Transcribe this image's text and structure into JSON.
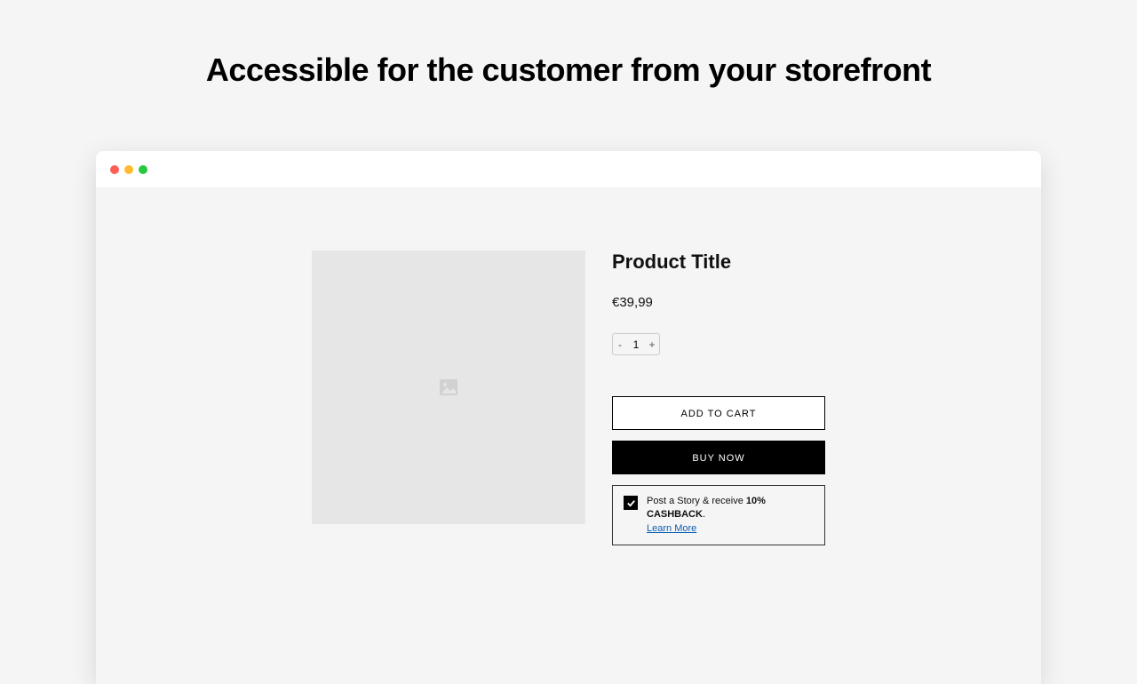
{
  "heading": "Accessible for the customer from your storefront",
  "product": {
    "title": "Product Title",
    "price": "€39,99",
    "quantity": {
      "minus": "-",
      "value": "1",
      "plus": "+"
    },
    "buttons": {
      "add_to_cart": "ADD TO CART",
      "buy_now": "BUY NOW"
    },
    "cashback": {
      "prefix": "Post a Story & receive ",
      "bold": "10% CASHBACK",
      "suffix": ".",
      "learn_more": "Learn More"
    }
  }
}
